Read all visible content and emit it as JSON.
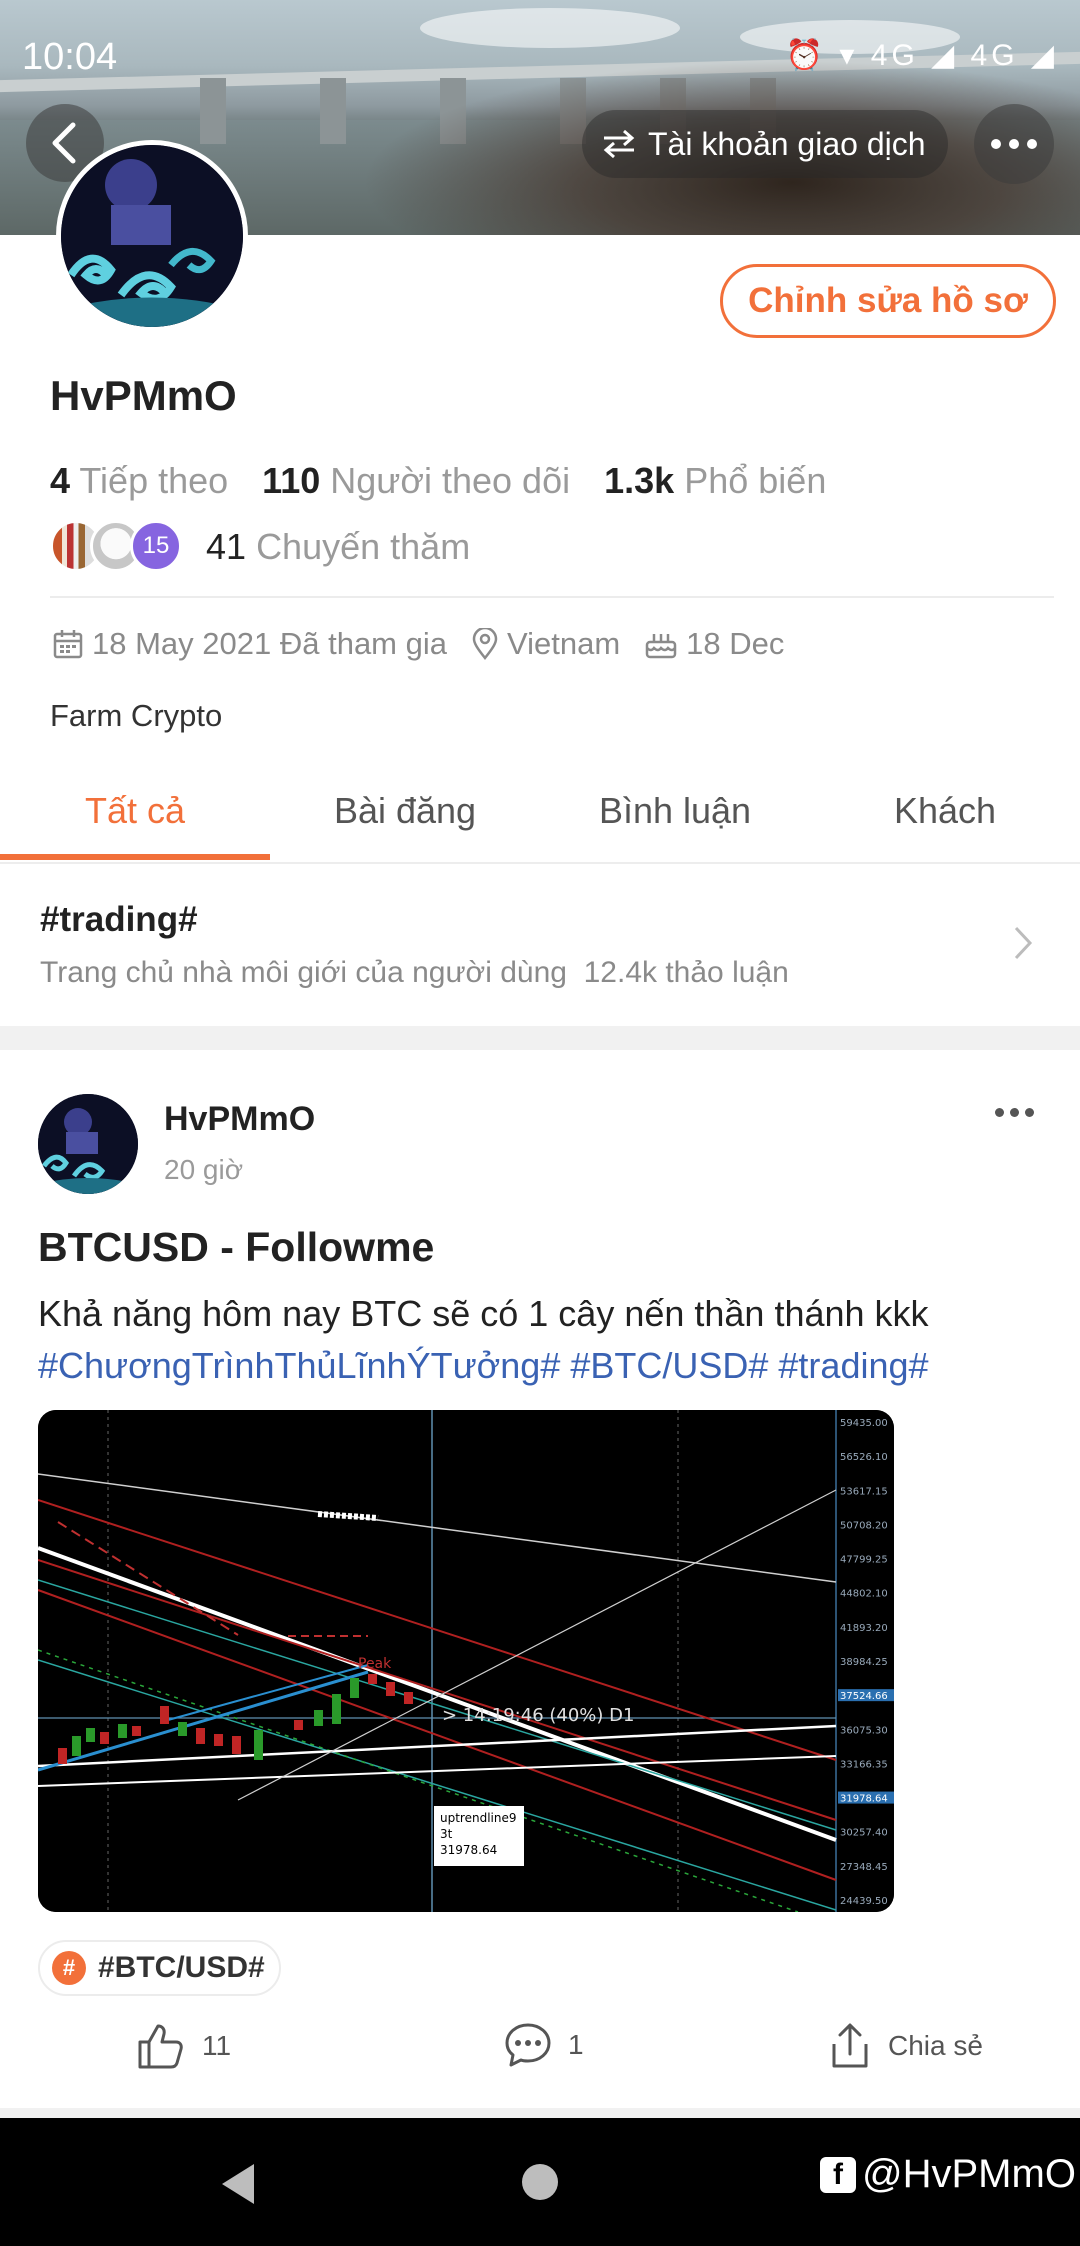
{
  "status_bar": {
    "time": "10:04",
    "icons": "⏰ ▾ 4G ◢ 4G ◢"
  },
  "header": {
    "account_label": "Tài khoản giao dịch",
    "edit_profile_label": "Chỉnh sửa hồ sơ"
  },
  "profile": {
    "username": "HvPMmO",
    "following_count": "4",
    "following_label": "Tiếp theo",
    "followers_count": "110",
    "followers_label": "Người theo dõi",
    "popularity_count": "1.3k",
    "popularity_label": "Phổ biến",
    "visitor_badge": "15",
    "visits_count": "41",
    "visits_label": "Chuyến thăm",
    "joined": "18 May 2021 Đã tham gia",
    "location": "Vietnam",
    "birthday": "18 Dec",
    "bio": "Farm Crypto"
  },
  "tabs": [
    "Tất cả",
    "Bài đăng",
    "Bình luận",
    "Khách"
  ],
  "topic": {
    "title": "#trading#",
    "subtitle": "Trang chủ nhà môi giới của người dùng",
    "discussions": "12.4k thảo luận"
  },
  "post": {
    "author": "HvPMmO",
    "time": "20 giờ",
    "title": "BTCUSD - Followme",
    "body": "Khả năng hôm nay BTC sẽ có 1 cây nến thần thánh kkk",
    "hashtags": "#ChươngTrìnhThủLĩnhÝTưởng# #BTC/USD# #trading#",
    "tag_chip": "#BTC/USD#",
    "likes": "11",
    "comments": "1",
    "share_label": "Chia sẻ",
    "chart": {
      "price_labels": [
        "59435.00",
        "56526.10",
        "53617.15",
        "50708.20",
        "47799.25",
        "44802.10",
        "41893.20",
        "38984.25",
        "37524.66",
        "36075.30",
        "33166.35",
        "31978.64",
        "30257.40",
        "27348.45",
        "24439.50"
      ],
      "annotation": "> 14:19:46 (40%) D1",
      "peak_label": "Peak",
      "tooltip_line1": "uptrendline9",
      "tooltip_line2": "3t",
      "tooltip_line3": "31978.64"
    }
  },
  "watermark": "@HvPMmO",
  "colors": {
    "accent": "#f2703a",
    "hashtag": "#3a62b3",
    "badge": "#8665e0"
  }
}
